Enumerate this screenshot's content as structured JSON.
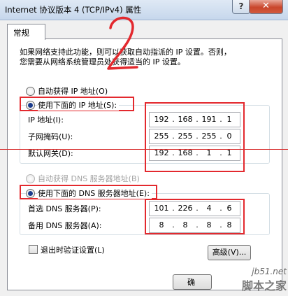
{
  "window": {
    "title": "Internet 协议版本 4 (TCP/IPv4) 属性",
    "help_glyph": "?",
    "close_glyph": "✕"
  },
  "tabs": [
    {
      "label": "常规"
    }
  ],
  "description": {
    "line1": "如果网络支持此功能，则可以获取自动指派的 IP 设置。否则，",
    "line2": "您需要从网络系统管理员处获得适当的 IP 设置。"
  },
  "ip_section": {
    "auto_label": "自动获得 IP 地址(O)",
    "manual_label": "使用下面的 IP 地址(S):",
    "selected": "manual",
    "fields": [
      {
        "label": "IP 地址(I):",
        "octets": [
          "192",
          "168",
          "191",
          "1"
        ]
      },
      {
        "label": "子网掩码(U):",
        "octets": [
          "255",
          "255",
          "255",
          "0"
        ]
      },
      {
        "label": "默认网关(D):",
        "octets": [
          "192",
          "168",
          "1",
          "1"
        ]
      }
    ]
  },
  "dns_section": {
    "auto_label": "自动获得 DNS 服务器地址(B)",
    "manual_label": "使用下面的 DNS 服务器地址(E):",
    "selected": "manual",
    "fields": [
      {
        "label": "首选 DNS 服务器(P):",
        "octets": [
          "101",
          "226",
          "4",
          "6"
        ]
      },
      {
        "label": "备用 DNS 服务器(A):",
        "octets": [
          "8",
          "8",
          "8",
          "8"
        ]
      }
    ]
  },
  "validate_checkbox": {
    "label": "退出时验证设置(L)",
    "checked": false
  },
  "buttons": {
    "advanced": "高级(V)...",
    "ok_partial": "确"
  },
  "annotation": {
    "number": "2"
  },
  "watermark": {
    "url": "jb51.net",
    "name": "脚本之家"
  },
  "colors": {
    "annotation_red": "#e3292e",
    "radio_selected": "#1b3c8c"
  }
}
